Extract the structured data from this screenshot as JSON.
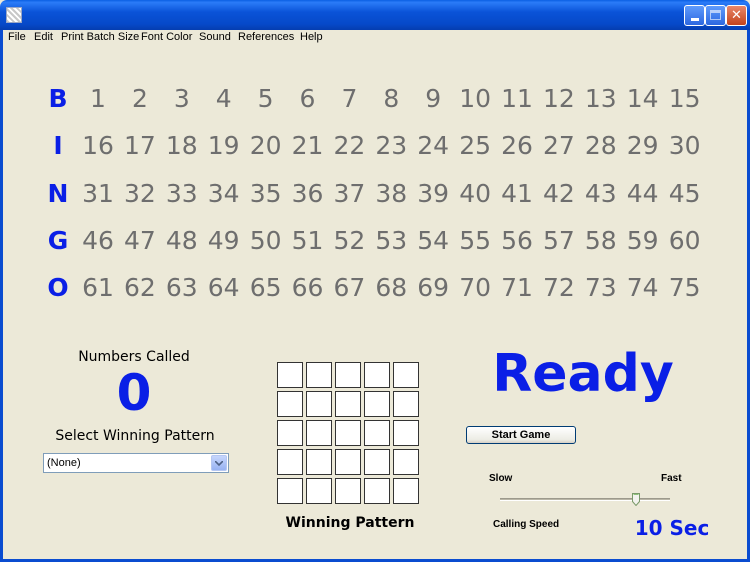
{
  "window": {
    "title": "",
    "icon": "app-icon"
  },
  "titlebar_buttons": {
    "minimize": "minimize-icon",
    "maximize": "maximize-icon",
    "close": "✕"
  },
  "menu": [
    "File",
    "Edit",
    "Print Batch Size",
    "Font Color",
    "Sound",
    "References",
    "Help"
  ],
  "board": {
    "letters": [
      "B",
      "I",
      "N",
      "G",
      "O"
    ],
    "rows": [
      [
        "1",
        "2",
        "3",
        "4",
        "5",
        "6",
        "7",
        "8",
        "9",
        "10",
        "11",
        "12",
        "13",
        "14",
        "15"
      ],
      [
        "16",
        "17",
        "18",
        "19",
        "20",
        "21",
        "22",
        "23",
        "24",
        "25",
        "26",
        "27",
        "28",
        "29",
        "30"
      ],
      [
        "31",
        "32",
        "33",
        "34",
        "35",
        "36",
        "37",
        "38",
        "39",
        "40",
        "41",
        "42",
        "43",
        "44",
        "45"
      ],
      [
        "46",
        "47",
        "48",
        "49",
        "50",
        "51",
        "52",
        "53",
        "54",
        "55",
        "56",
        "57",
        "58",
        "59",
        "60"
      ],
      [
        "61",
        "62",
        "63",
        "64",
        "65",
        "66",
        "67",
        "68",
        "69",
        "70",
        "71",
        "72",
        "73",
        "74",
        "75"
      ]
    ]
  },
  "numbers_called": {
    "label": "Numbers Called",
    "count": "0"
  },
  "pattern_select": {
    "label": "Select Winning Pattern",
    "value": "(None)"
  },
  "winning_pattern": {
    "label": "Winning Pattern",
    "size": 5
  },
  "status": "Ready",
  "start_button": "Start Game",
  "speed": {
    "slow_label": "Slow",
    "fast_label": "Fast",
    "caption": "Calling Speed",
    "level": 0.8,
    "seconds_display": "10 Sec"
  },
  "colors": {
    "accent": "#0A1FE6",
    "number": "#6E6E6E",
    "background": "#ECE9D8"
  }
}
